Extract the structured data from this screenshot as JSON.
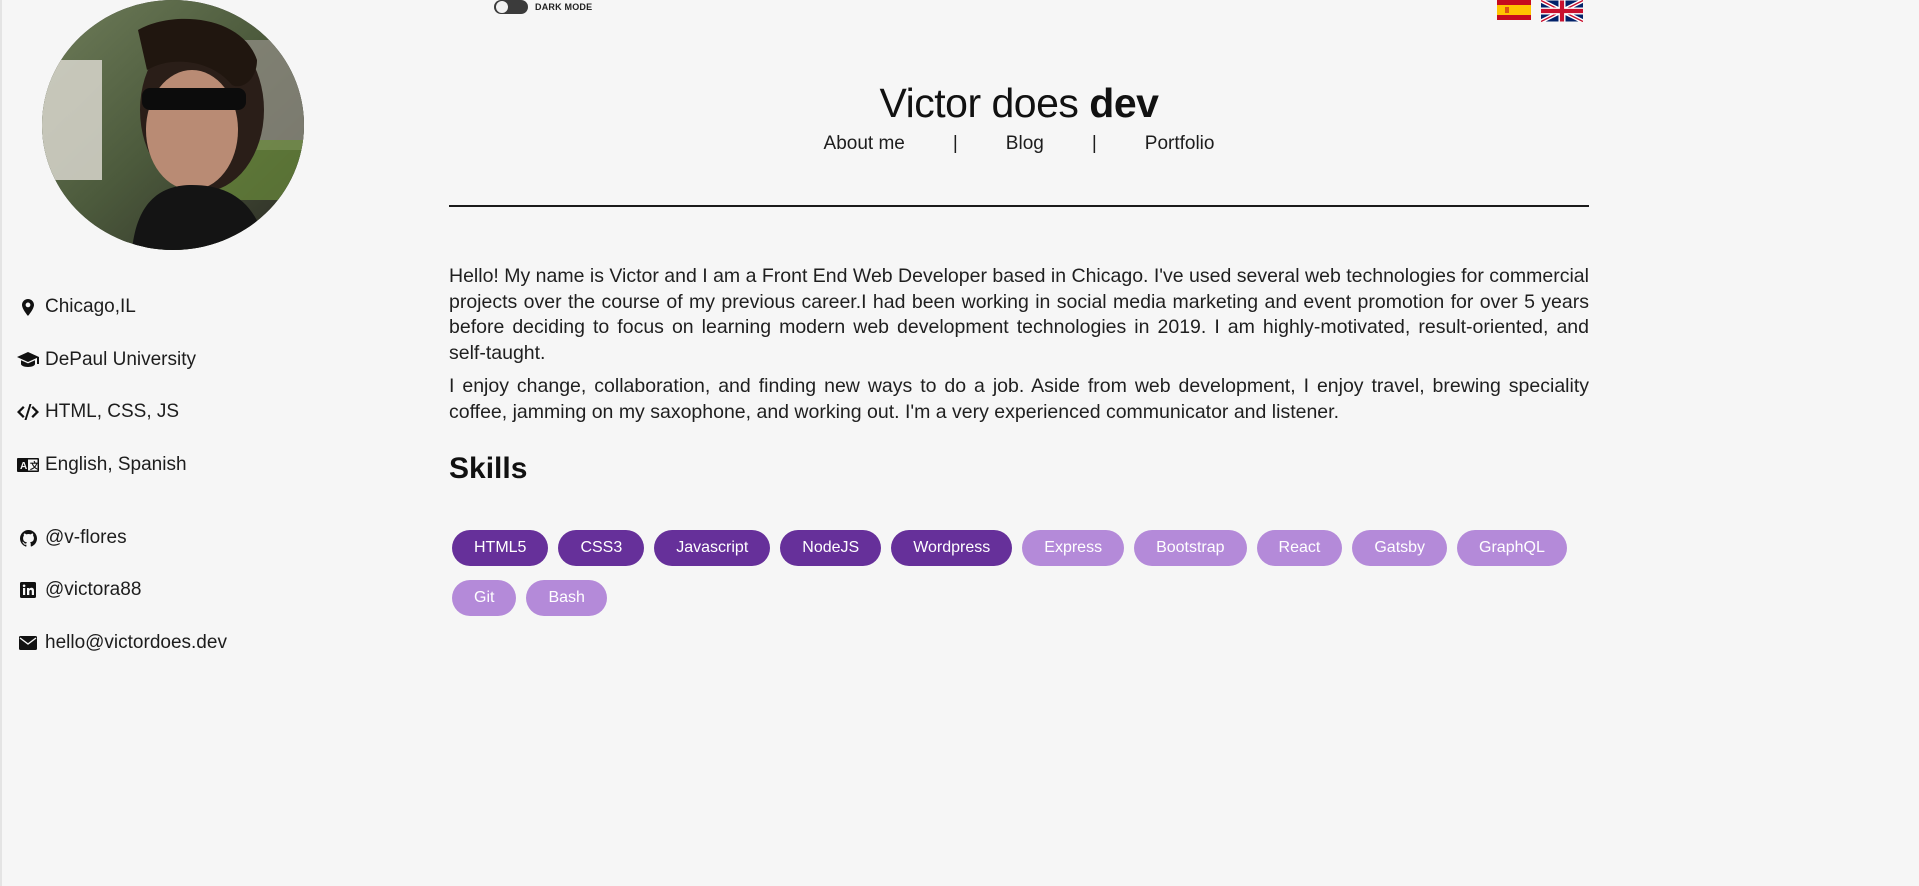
{
  "topbar": {
    "dark_mode_label": "DARK MODE",
    "dark_mode_on": false,
    "languages": [
      {
        "code": "es",
        "icon": "spain-flag-icon"
      },
      {
        "code": "en",
        "icon": "uk-flag-icon"
      }
    ]
  },
  "sidebar": {
    "details": [
      {
        "icon": "map-marker-icon",
        "text": "Chicago,IL"
      },
      {
        "icon": "graduation-cap-icon",
        "text": "DePaul University"
      },
      {
        "icon": "code-icon",
        "text": "HTML, CSS, JS"
      },
      {
        "icon": "language-icon",
        "text": "English, Spanish"
      }
    ],
    "contacts": [
      {
        "icon": "github-icon",
        "text": "@v-flores"
      },
      {
        "icon": "linkedin-icon",
        "text": "@victora88"
      },
      {
        "icon": "envelope-icon",
        "text": "hello@victordoes.dev"
      }
    ]
  },
  "header": {
    "title_prefix": "Victor does ",
    "title_bold": "dev",
    "nav": [
      {
        "label": "About me"
      },
      {
        "label": "Blog"
      },
      {
        "label": "Portfolio"
      }
    ],
    "nav_separator": "|"
  },
  "about": {
    "paragraphs": [
      "Hello! My name is Victor and I am a Front End Web Developer based in Chicago. I've used several web technologies for commercial projects over the course of my previous career.I had been working in social media marketing and event promotion for over 5 years before deciding to focus on learning modern web development technologies in 2019. I am highly-motivated, result-oriented, and self-taught.",
      "I enjoy change, collaboration, and finding new ways to do a job. Aside from web development, I enjoy travel, brewing speciality coffee, jamming on my saxophone, and working out. I'm a very experienced communicator and listener."
    ]
  },
  "skills": {
    "title": "Skills",
    "items": [
      {
        "label": "HTML5",
        "tier": "dark"
      },
      {
        "label": "CSS3",
        "tier": "dark"
      },
      {
        "label": "Javascript",
        "tier": "dark"
      },
      {
        "label": "NodeJS",
        "tier": "dark"
      },
      {
        "label": "Wordpress",
        "tier": "dark"
      },
      {
        "label": "Express",
        "tier": "light"
      },
      {
        "label": "Bootstrap",
        "tier": "light"
      },
      {
        "label": "React",
        "tier": "light"
      },
      {
        "label": "Gatsby",
        "tier": "light"
      },
      {
        "label": "GraphQL",
        "tier": "light"
      },
      {
        "label": "Git",
        "tier": "light"
      },
      {
        "label": "Bash",
        "tier": "light"
      }
    ]
  },
  "colors": {
    "background": "#f6f6f6",
    "skill_dark": "#66309a",
    "skill_light": "#b48ad9",
    "text": "#1a1a1a"
  }
}
